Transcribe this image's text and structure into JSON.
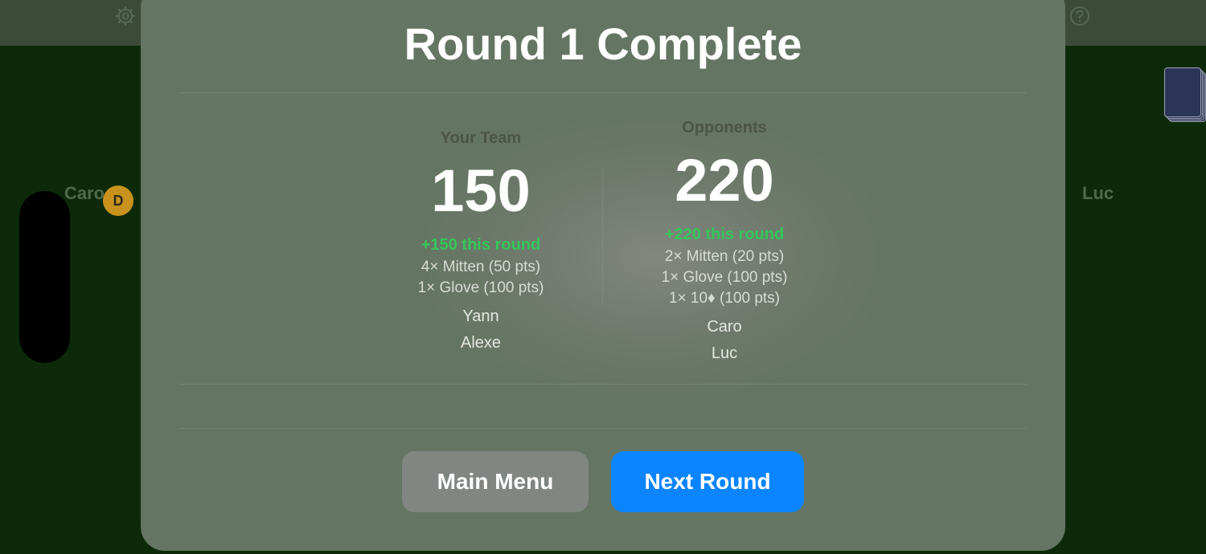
{
  "background": {
    "left_player": "Caro",
    "right_player": "Luc",
    "dealer_badge": "D",
    "icons": [
      "gear-icon",
      "help-icon"
    ]
  },
  "modal": {
    "title": "Round 1 Complete",
    "teams": [
      {
        "label": "Your Team",
        "score": "150",
        "delta": "+150 this round",
        "breakdown": [
          "4× Mitten (50 pts)",
          "1× Glove (100 pts)"
        ],
        "players": [
          "Yann",
          "Alexe"
        ]
      },
      {
        "label": "Opponents",
        "score": "220",
        "delta": "+220 this round",
        "breakdown": [
          "2× Mitten (20 pts)",
          "1× Glove (100 pts)",
          "1× 10♦ (100 pts)"
        ],
        "players": [
          "Caro",
          "Luc"
        ]
      }
    ],
    "buttons": {
      "main_menu": "Main Menu",
      "next_round": "Next Round"
    }
  },
  "colors": {
    "table_green": "#0c2a0a",
    "accent_blue": "#0a84ff",
    "delta_green": "#34c759",
    "secondary_button": "#818683"
  }
}
